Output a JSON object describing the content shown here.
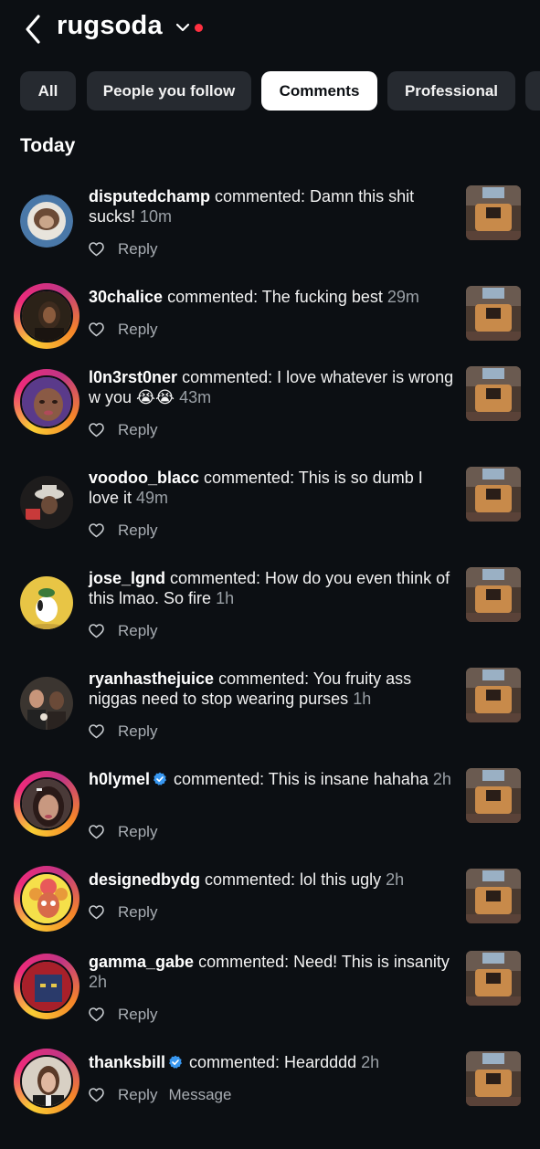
{
  "header": {
    "account_name": "rugsoda"
  },
  "chips": [
    {
      "label": "All"
    },
    {
      "label": "People you follow"
    },
    {
      "label": "Comments"
    },
    {
      "label": "Professional"
    },
    {
      "label": ""
    }
  ],
  "active_chip": "Comments",
  "section_title": "Today",
  "reply_label": "Reply",
  "message_label": "Message",
  "comments": [
    {
      "user": "disputedchamp",
      "text": " commented: Damn this shit sucks! ",
      "time": "10m"
    },
    {
      "user": "30chalice",
      "text": " commented: The fucking best ",
      "time": "29m"
    },
    {
      "user": "l0n3rst0ner",
      "text": " commented: I love whatever is wrong w you 😭😭 ",
      "time": "43m"
    },
    {
      "user": "voodoo_blacc",
      "text": " commented: This is so dumb I love it ",
      "time": "49m"
    },
    {
      "user": "jose_lgnd",
      "text": " commented: How do you even think of this lmao. So fire ",
      "time": "1h"
    },
    {
      "user": "ryanhasthejuice",
      "text": " commented: You fruity ass niggas need to stop wearing purses ",
      "time": "1h"
    },
    {
      "user": "h0lymel",
      "text": " commented: This is insane hahaha ",
      "time": "2h"
    },
    {
      "user": "designedbydg",
      "text": " commented: lol this ugly ",
      "time": "2h"
    },
    {
      "user": "gamma_gabe",
      "text": " commented: Need! This is insanity ",
      "time": "2h"
    },
    {
      "user": "thanksbill",
      "text": " commented: Heardddd ",
      "time": "2h"
    }
  ],
  "colors": {
    "background": "#0c0f13",
    "chip_bg": "#262a30",
    "chip_active_bg": "#ffffff",
    "muted_text": "#9aa0a6",
    "notification_dot": "#ff3040",
    "verified_badge": "#3897f0"
  },
  "icons": [
    "back-arrow-icon",
    "chevron-down-icon",
    "heart-icon",
    "verified-badge-icon"
  ]
}
